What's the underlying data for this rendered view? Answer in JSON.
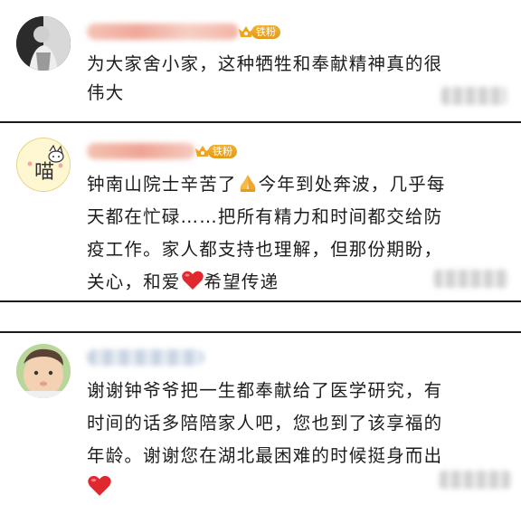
{
  "comments": [
    {
      "badge": "铁粉",
      "lines": [
        "为大家舍小家，这种牺牲和奉献精神真的很",
        "伟大"
      ]
    },
    {
      "badge": "铁粉",
      "avatar_glyph": "喵",
      "lines": [
        "钟南山院士辛苦了",
        "今年到处奔波，几乎每",
        "天都在忙碌……把所有精力和时间都交给防",
        "疫工作。家人都支持也理解，但那份期盼，",
        "关心，和爱",
        "希望传递"
      ]
    },
    {
      "lines": [
        "谢谢钟爷爷把一生都奉献给了医学研究，有",
        "时间的话多陪陪家人吧，您也到了该享福的",
        "年龄。谢谢您在湖北最困难的时候挺身而出"
      ]
    }
  ],
  "icons": [
    "pray-icon",
    "red-heart-icon",
    "crown-icon"
  ],
  "colors": {
    "badge": "#e8a020",
    "heart": "#e0282e",
    "divider": "#1a1a1a"
  }
}
